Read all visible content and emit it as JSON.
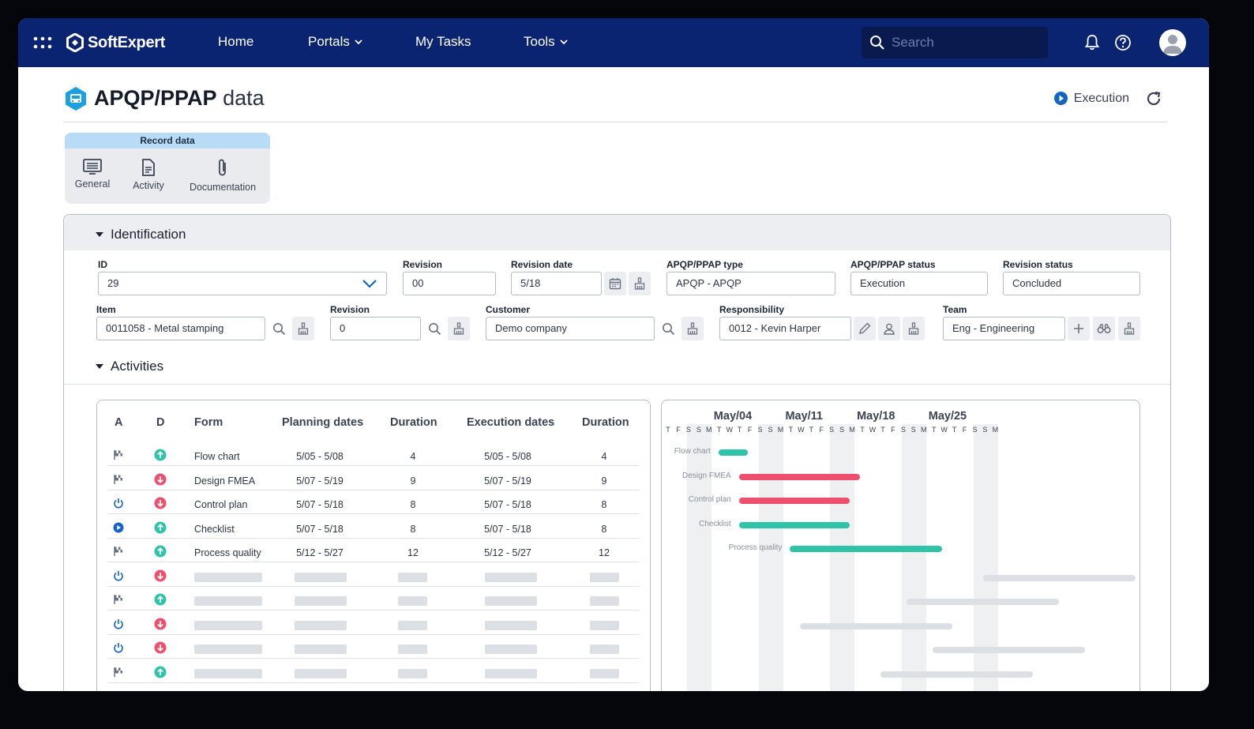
{
  "brand": {
    "name": "SoftExpert"
  },
  "nav": {
    "home": "Home",
    "portals": "Portals",
    "my_tasks": "My Tasks",
    "tools": "Tools"
  },
  "search": {
    "placeholder": "Search"
  },
  "header": {
    "title_bold": "APQP/PPAP",
    "title_light": "data",
    "status": "Execution"
  },
  "record_tabs": {
    "title": "Record data",
    "items": [
      {
        "label": "General",
        "icon": "list-icon"
      },
      {
        "label": "Activity",
        "icon": "document-icon"
      },
      {
        "label": "Documentation",
        "icon": "paperclip-icon"
      }
    ]
  },
  "identification": {
    "title": "Identification",
    "fields": {
      "id": {
        "label": "ID",
        "value": "29"
      },
      "revision": {
        "label": "Revision",
        "value": "00"
      },
      "revision_date": {
        "label": "Revision date",
        "value": "5/18"
      },
      "type": {
        "label": "APQP/PPAP type",
        "value": "APQP - APQP"
      },
      "status": {
        "label": "APQP/PPAP status",
        "value": "Execution"
      },
      "revision_status": {
        "label": "Revision status",
        "value": "Concluded"
      },
      "item": {
        "label": "Item",
        "value": "0011058 - Metal stamping"
      },
      "item_revision": {
        "label": "Revision",
        "value": "0"
      },
      "customer": {
        "label": "Customer",
        "value": "Demo company"
      },
      "responsibility": {
        "label": "Responsibility",
        "value": "0012 - Kevin Harper"
      },
      "team": {
        "label": "Team",
        "value": "Eng - Engineering"
      }
    }
  },
  "activities": {
    "title": "Activities",
    "columns": [
      "A",
      "D",
      "Form",
      "Planning dates",
      "Duration",
      "Execution dates",
      "Duration"
    ],
    "rows": [
      {
        "a": "flag",
        "d": "up",
        "form": "Flow chart",
        "planning": "5/05 - 5/08",
        "duration": "4",
        "execution": "5/05 - 5/08",
        "exec_duration": "4"
      },
      {
        "a": "flag",
        "d": "down",
        "form": "Design FMEA",
        "planning": "5/07 - 5/19",
        "duration": "9",
        "execution": "5/07 - 5/19",
        "exec_duration": "9"
      },
      {
        "a": "power",
        "d": "down",
        "form": "Control plan",
        "planning": "5/07 - 5/18",
        "duration": "8",
        "execution": "5/07 - 5/18",
        "exec_duration": "8"
      },
      {
        "a": "play",
        "d": "up",
        "form": "Checklist",
        "planning": "5/07 - 5/18",
        "duration": "8",
        "execution": "5/07 - 5/18",
        "exec_duration": "8"
      },
      {
        "a": "flag",
        "d": "up",
        "form": "Process quality",
        "planning": "5/12 - 5/27",
        "duration": "12",
        "execution": "5/12 - 5/27",
        "exec_duration": "12"
      }
    ],
    "placeholder_rows": [
      {
        "a": "power",
        "d": "down"
      },
      {
        "a": "flag",
        "d": "up"
      },
      {
        "a": "power",
        "d": "down"
      },
      {
        "a": "power",
        "d": "down"
      },
      {
        "a": "flag",
        "d": "up"
      }
    ]
  },
  "gantt": {
    "weeks": [
      "May/04",
      "May/11",
      "May/18",
      "May/25"
    ],
    "days": [
      "T",
      "F",
      "S",
      "S",
      "M",
      "T",
      "W",
      "T",
      "F",
      "S",
      "S",
      "M",
      "T",
      "W",
      "T",
      "F",
      "S",
      "S",
      "M",
      "T",
      "W",
      "T",
      "F",
      "S",
      "S",
      "M",
      "T",
      "W",
      "T",
      "F",
      "S",
      "S",
      "M"
    ],
    "first_day": 1,
    "tasks": [
      {
        "label": "Flow chart",
        "start": 5,
        "end": 8,
        "color": "#2fc3a8"
      },
      {
        "label": "Design FMEA",
        "start": 7,
        "end": 19,
        "color": "#ee4f6e"
      },
      {
        "label": "Control plan",
        "start": 7,
        "end": 18,
        "color": "#ee4f6e"
      },
      {
        "label": "Checklist",
        "start": 7,
        "end": 18,
        "color": "#2fc3a8"
      },
      {
        "label": "Process quality",
        "start": 12,
        "end": 27,
        "color": "#2fc3a8"
      }
    ],
    "colors": {
      "up": "#2fc3a8",
      "down": "#ee4f6e",
      "accent": "#1565c0",
      "brand": "#0a2472"
    }
  }
}
